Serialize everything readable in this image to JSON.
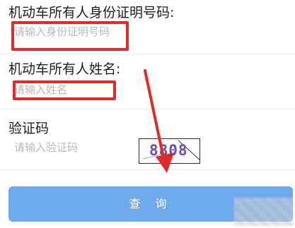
{
  "form": {
    "id_label": "机动车所有人身份证明号码:",
    "id_placeholder": "请输入身份证明号码",
    "name_label": "机动车所有人姓名:",
    "name_placeholder": "请输入姓名",
    "captcha_label": "验证码",
    "captcha_placeholder": "请输入验证码",
    "captcha_value": "8808"
  },
  "actions": {
    "query_label": "查 询"
  },
  "colors": {
    "highlight": "#e12a2a",
    "button": "#6ea9ec",
    "placeholder": "#b9b9b9"
  }
}
